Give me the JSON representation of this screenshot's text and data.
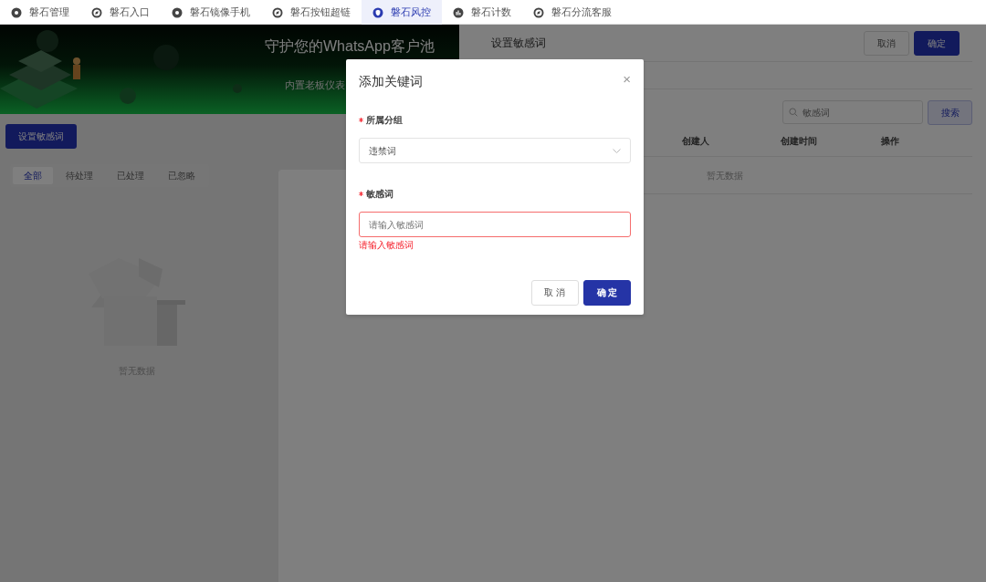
{
  "top_tabs": [
    {
      "label": "磐石管理",
      "kind": "gear",
      "selected": false
    },
    {
      "label": "磐石入口",
      "kind": "compass",
      "selected": false
    },
    {
      "label": "磐石镜像手机",
      "kind": "gear",
      "selected": false
    },
    {
      "label": "磐石按钮超链",
      "kind": "compass",
      "selected": false
    },
    {
      "label": "磐石风控",
      "kind": "shield",
      "selected": true
    },
    {
      "label": "磐石计数",
      "kind": "chart",
      "selected": false
    },
    {
      "label": "磐石分流客服",
      "kind": "compass",
      "selected": false
    }
  ],
  "banner": {
    "title": "守护您的WhatsApp客户池",
    "subtitle": "内置老板仪表"
  },
  "page": {
    "primary_button": "设置敏感词",
    "filter_tabs": [
      {
        "label": "全部",
        "selected": true
      },
      {
        "label": "待处理",
        "selected": false
      },
      {
        "label": "已处理",
        "selected": false
      },
      {
        "label": "已忽略",
        "selected": false
      }
    ],
    "empty_text": "暂无数据"
  },
  "drawer": {
    "title": "设置敏感词",
    "buttons": [
      {
        "label": "取消",
        "kind": "default"
      },
      {
        "label": "确定",
        "kind": "primary"
      }
    ],
    "search": {
      "placeholder": "敏感词"
    },
    "search_button": "搜索",
    "columns": [
      "创建人",
      "创建时间",
      "操作"
    ],
    "empty_text": "暂无数据"
  },
  "modal": {
    "title": "添加关键词",
    "close": "×",
    "fields": [
      {
        "label": "所属分组",
        "required": true,
        "kind": "select",
        "value": "违禁词"
      },
      {
        "label": "敏感词",
        "required": true,
        "kind": "input",
        "placeholder": "请输入敏感词",
        "error": "请输入敏感词"
      }
    ],
    "buttons": [
      {
        "label": "取 消",
        "kind": "default"
      },
      {
        "label": "确 定",
        "kind": "primary"
      }
    ]
  }
}
